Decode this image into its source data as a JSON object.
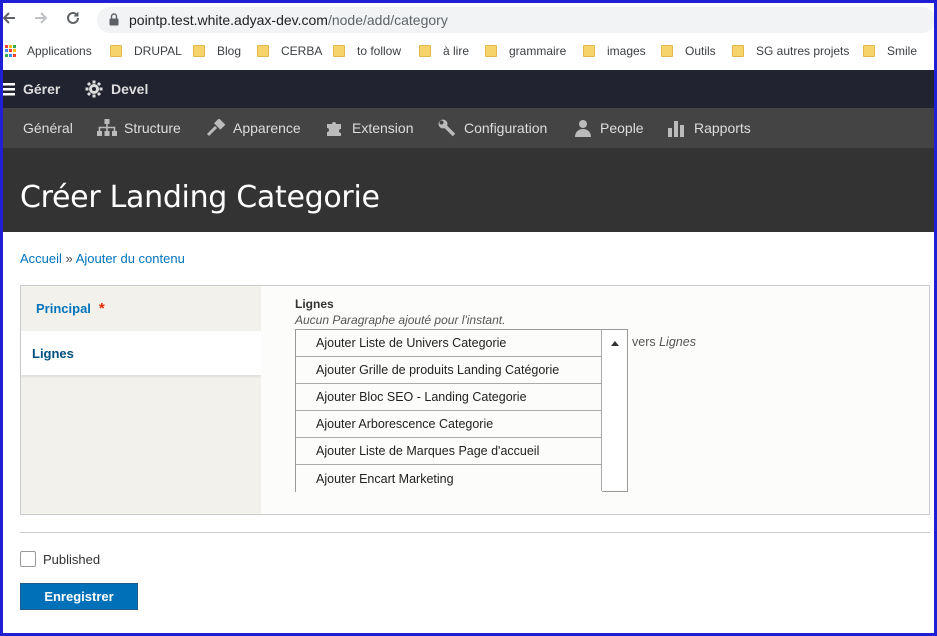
{
  "browser": {
    "url_host": "pointp.test.white.adyax-dev.com",
    "url_path": "/node/add/category",
    "back_icon": "arrow-left-icon",
    "forward_icon": "arrow-right-icon",
    "reload_icon": "reload-icon"
  },
  "bookmarks": {
    "apps_label": "Applications",
    "items": [
      "DRUPAL",
      "Blog",
      "CERBA",
      "to follow",
      "à lire",
      "grammaire",
      "images",
      "Outils",
      "SG autres projets",
      "Smile"
    ]
  },
  "admin_toolbar": {
    "manage_label": "Gérer",
    "devel_label": "Devel"
  },
  "admin_tray": {
    "items": [
      "Général",
      "Structure",
      "Apparence",
      "Extension",
      "Configuration",
      "People",
      "Rapports"
    ]
  },
  "page": {
    "title": "Créer Landing Categorie"
  },
  "breadcrumb": {
    "home": "Accueil",
    "separator": "»",
    "add_content": "Ajouter du contenu"
  },
  "vertical_tabs": {
    "tabs": [
      {
        "label": "Principal",
        "required_mark": "*"
      },
      {
        "label": "Lignes"
      }
    ]
  },
  "lignes_pane": {
    "label": "Lignes",
    "empty_text": "Aucun Paragraphe ajouté pour l'instant.",
    "vers_text": "vers",
    "vers_target": "Lignes",
    "dropdown_items": [
      "Ajouter Liste de Univers Categorie",
      "Ajouter Grille de produits Landing Catégorie",
      "Ajouter Bloc SEO - Landing Categorie",
      "Ajouter Arborescence Categorie",
      "Ajouter Liste de Marques Page d'accueil",
      "Ajouter Encart Marketing"
    ]
  },
  "form": {
    "published_label": "Published",
    "published_checked": false,
    "save_label": "Enregistrer"
  },
  "colors": {
    "frame": "#1f20d6",
    "admin_bar": "#222330",
    "tray": "#444444",
    "header": "#333333",
    "link": "#0074bd",
    "primary_button": "#0071b8",
    "required": "#e32700"
  }
}
